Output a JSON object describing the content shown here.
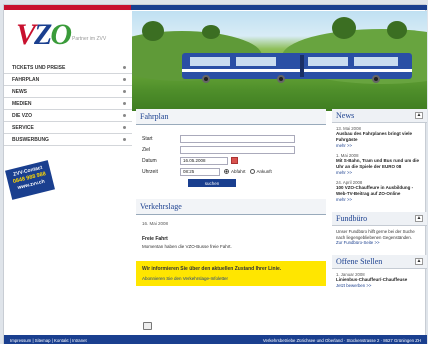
{
  "header": {
    "logo_text_v": "V",
    "logo_text_z": "Z",
    "logo_text_o": "O",
    "tagline": "Partner im ZVV"
  },
  "nav": {
    "items": [
      {
        "label": "TICKETS UND PREISE"
      },
      {
        "label": "FAHRPLAN"
      },
      {
        "label": "NEWS"
      },
      {
        "label": "MEDIEN"
      },
      {
        "label": "DIE VZO"
      },
      {
        "label": "SERVICE"
      },
      {
        "label": "BUSWERBUNG"
      }
    ]
  },
  "badge": {
    "line1": "ZVV-Contact",
    "line2": "0848 988 988",
    "line3": "www.zvv.ch"
  },
  "fahrplan": {
    "title": "Fahrplan",
    "start_label": "Start",
    "ziel_label": "Ziel",
    "datum_label": "Datum",
    "datum_value": "16.05.2008",
    "uhrzeit_label": "Uhrzeit",
    "uhrzeit_value": "08:25",
    "abfahrt_label": "Abfahrt",
    "ankunft_label": "Ankunft",
    "submit_label": "suchen"
  },
  "verkehrslage": {
    "title": "Verkehrslage",
    "date": "16. Mai 2008",
    "item_title": "Freie Fahrt",
    "item_text": "Momentan haben die VZO-Busse freie Fahrt."
  },
  "notice": {
    "text1": "Wir informieren Sie über den aktuellen Zustand Ihrer Linie.",
    "text2": "Abonnieren Sie den Verkehrslage-Infoletter"
  },
  "news": {
    "title": "News",
    "items": [
      {
        "date": "13. Mai 2008",
        "title": "Ausbau des Fahrplanes bringt viele Fahrgäste",
        "more": "mehr >>"
      },
      {
        "date": "1. Mai 2008",
        "title": "Mit S-Bahn, Tram und Bus rund um die Uhr an die Spiele der EURO 08",
        "more": "mehr >>"
      },
      {
        "date": "24. April 2008",
        "title": "100 VZO-Chauffeure in Ausbildung - Web-TV-Beitrag auf ZO-Online",
        "more": "mehr >>"
      }
    ]
  },
  "fundbuero": {
    "title": "Fundbüro",
    "text": "Unser Fundbüro hilft gerne bei der Suche nach liegengebliebenen Gegenständen.",
    "link": "Zur Fundbüro-Seite >>"
  },
  "stellen": {
    "title": "Offene Stellen",
    "date": "1. Januar 2008",
    "item_title": "Linienbus-Chauffeur/-Chauffeuse",
    "link": "Jetzt bewerben >>"
  },
  "footer": {
    "links": "Impressum | Sitemap | Kontakt | Intranet",
    "address": "Verkehrsbetriebe Zürichsee und Oberland · Stockenstrasse 2 · 8627 Grüningen ZH"
  },
  "colors": {
    "brand_blue": "#1a3f8f",
    "brand_red": "#c8102e",
    "brand_green": "#3a9b3a",
    "notice_yellow": "#ffe600"
  }
}
